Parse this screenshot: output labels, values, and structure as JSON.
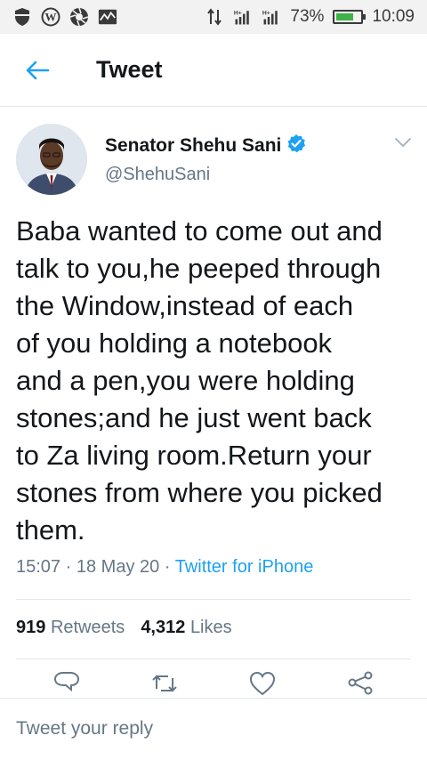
{
  "status_bar": {
    "left_icons": [
      "shield-icon",
      "wordpress-icon",
      "aperture-icon",
      "activity-icon"
    ],
    "network_icons": [
      "data-arrows-icon",
      "signal-h-plus-icon",
      "signal-h-plus-icon"
    ],
    "battery_text": "73%",
    "battery_level": 0.73,
    "time": "10:09"
  },
  "header": {
    "title": "Tweet"
  },
  "tweet": {
    "author": {
      "display_name": "Senator Shehu Sani",
      "handle": "@ShehuSani",
      "verified": true
    },
    "text": "Baba wanted to come out and\ntalk to you,he peeped through\nthe Window,instead of each\nof you holding a notebook\nand a pen,you were holding\nstones;and he just went back\nto Za living room.Return your\nstones from where you picked\nthem.",
    "time": "15:07",
    "date": "18 May 20",
    "separator": "·",
    "source": "Twitter for iPhone",
    "retweets_count": "919",
    "retweets_label": "Retweets",
    "likes_count": "4,312",
    "likes_label": "Likes"
  },
  "reply": {
    "placeholder": "Tweet your reply"
  },
  "colors": {
    "accent": "#1da1f2",
    "secondary_text": "#657786",
    "divider": "#e1e8ed"
  }
}
